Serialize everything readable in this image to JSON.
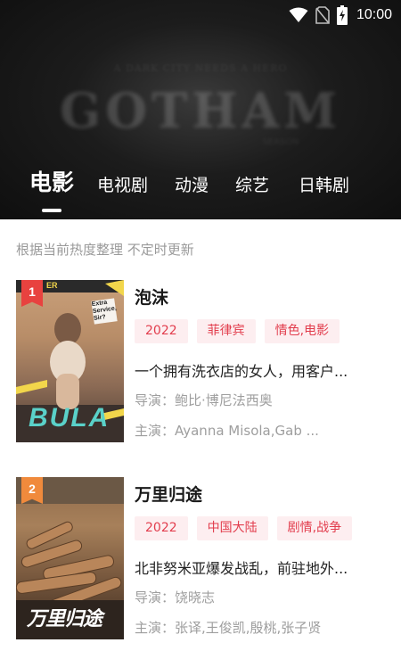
{
  "status_bar": {
    "time": "10:00",
    "icons": [
      "wifi-icon",
      "no-sim-icon",
      "battery-charging-icon"
    ]
  },
  "banner": {
    "line1": "A DARK CITY NEEDS A HERO",
    "title": "GOTHAM",
    "line3": "SEASON"
  },
  "tabs": [
    {
      "label": "电影",
      "active": true
    },
    {
      "label": "电视剧",
      "active": false
    },
    {
      "label": "动漫",
      "active": false
    },
    {
      "label": "综艺",
      "active": false
    },
    {
      "label": "日韩剧",
      "active": false
    }
  ],
  "subtitle": "根据当前热度整理 不定时更新",
  "colors": {
    "tag_bg": "#fdeef0",
    "tag_text": "#e23d4d",
    "rank1_badge": "#e8423f",
    "rank2_badge": "#f08a3c"
  },
  "items": [
    {
      "rank": "1",
      "title": "泡沫",
      "tags": [
        "2022",
        "菲律宾",
        "情色,电影"
      ],
      "description": "一个拥有洗衣店的女人，用客户...",
      "director": "导演：鲍比·博尼法西奥",
      "cast": "主演：Ayanna Misola,Gab ...",
      "poster_text": {
        "badge": "Extra Service, Sir?",
        "logo": "BULA",
        "top": "ER"
      }
    },
    {
      "rank": "2",
      "title": "万里归途",
      "tags": [
        "2022",
        "中国大陆",
        "剧情,战争"
      ],
      "description": "北非努米亚爆发战乱，前驻地外...",
      "director": "导演：饶晓志",
      "cast": "主演：张译,王俊凯,殷桃,张子贤",
      "poster_text": {
        "logo": "万里归途"
      }
    }
  ]
}
